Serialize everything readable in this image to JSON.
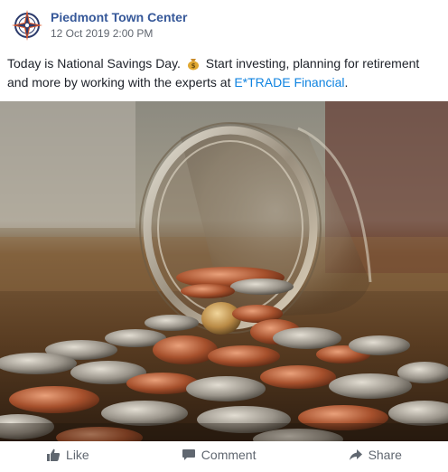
{
  "post": {
    "page_name": "Piedmont Town Center",
    "timestamp": "12 Oct 2019 2:00 PM",
    "text_before": "Today is National Savings Day.",
    "text_after": " Start investing, planning for retirement and more by working with the experts at ",
    "link_text": "E*TRADE Financial",
    "text_end": "."
  },
  "actions": {
    "like": "Like",
    "comment": "Comment",
    "share": "Share"
  },
  "colors": {
    "page_name": "#365899",
    "link": "#0f83e0",
    "action_text": "#606770"
  },
  "icons": [
    "compass-logo-icon",
    "money-bag-icon",
    "thumbs-up-icon",
    "comment-icon",
    "share-arrow-icon"
  ]
}
